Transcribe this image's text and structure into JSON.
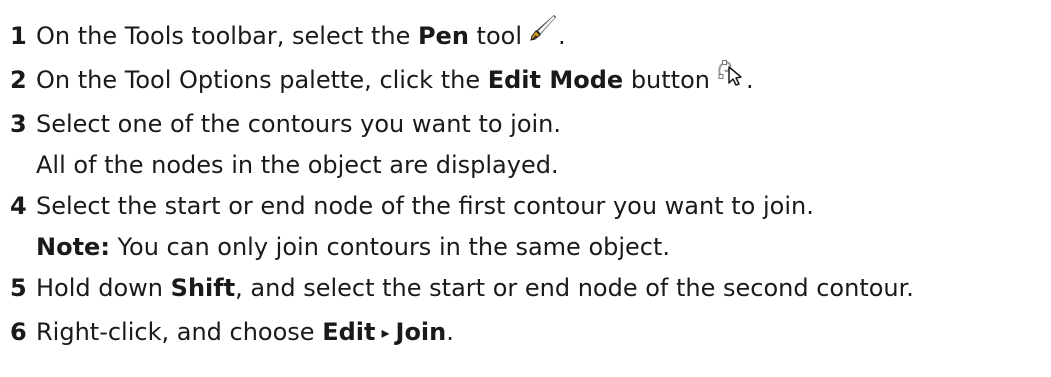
{
  "steps": [
    {
      "number": "1",
      "pre": "On the Tools toolbar, select the ",
      "bold": "Pen",
      "post": " tool",
      "icon": "pen-tool-icon",
      "end": "."
    },
    {
      "number": "2",
      "pre": "On the Tool Options palette, click the ",
      "bold": "Edit Mode",
      "post": " button",
      "icon": "edit-mode-icon",
      "end": "."
    },
    {
      "number": "3",
      "text": "Select one of the contours you want to join.",
      "result": "All of the nodes in the object are displayed."
    },
    {
      "number": "4",
      "text": "Select the start or end node of the first contour you want to join.",
      "note_label": "Note:",
      "note_text": " You can only join contours in the same object."
    },
    {
      "number": "5",
      "pre": "Hold down ",
      "bold": "Shift",
      "post": ", and select the start or end node of the second contour."
    },
    {
      "number": "6",
      "pre": "Right-click, and choose ",
      "menu1": "Edit",
      "menu_sep": "▸",
      "menu2": "Join",
      "end": "."
    }
  ]
}
